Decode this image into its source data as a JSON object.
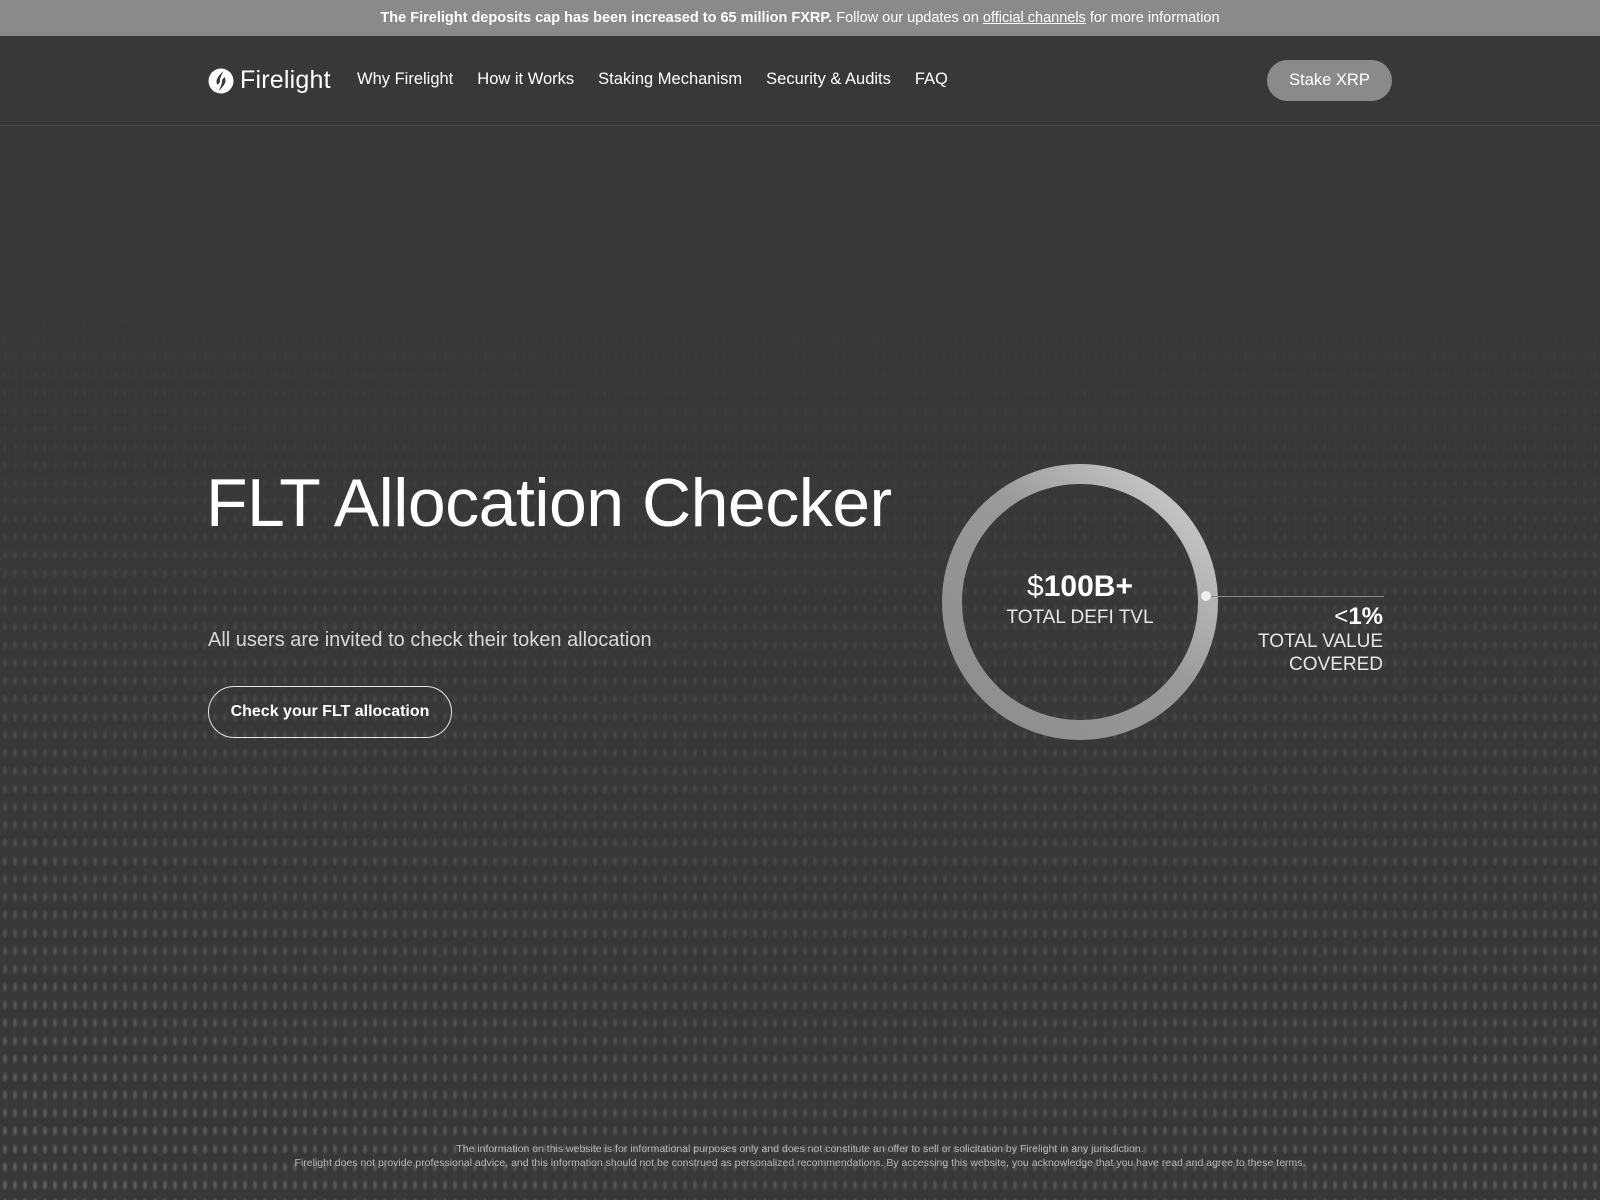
{
  "announcement": {
    "bold_text": "The Firelight deposits cap has been increased to 65 million FXRP.",
    "text_before_link": "Follow our updates on",
    "link_text": "official channels",
    "text_after_link": "for more information"
  },
  "nav": {
    "logo_text": "Firelight",
    "links": [
      "Why Firelight",
      "How it Works",
      "Staking Mechanism",
      "Security & Audits",
      "FAQ"
    ],
    "cta_label": "Stake XRP"
  },
  "hero": {
    "title": "FLT Allocation Checker",
    "subtitle": "All users are invited to check their token allocation",
    "button_label": "Check your FLT allocation"
  },
  "stats": {
    "ring_prefix": "$",
    "ring_value": "100B+",
    "ring_label": "TOTAL DEFI TVL",
    "pct_prefix": "<",
    "pct_value": "1%",
    "pct_label_line1": "TOTAL VALUE",
    "pct_label_line2": "COVERED"
  },
  "footer": {
    "disclaimer_line1": "The information on this website is for informational purposes only and does not constitute an offer to sell or solicitation by Firelight in any jurisdiction.",
    "disclaimer_line2": "Firelight does not provide professional advice, and this information should not be construed as personalized recommendations. By accessing this website, you acknowledge that you have read and agree to these terms."
  },
  "colors": {
    "background": "#383838",
    "announcement_bar": "#8a8a8a",
    "button_gray": "#8a8a8a"
  }
}
